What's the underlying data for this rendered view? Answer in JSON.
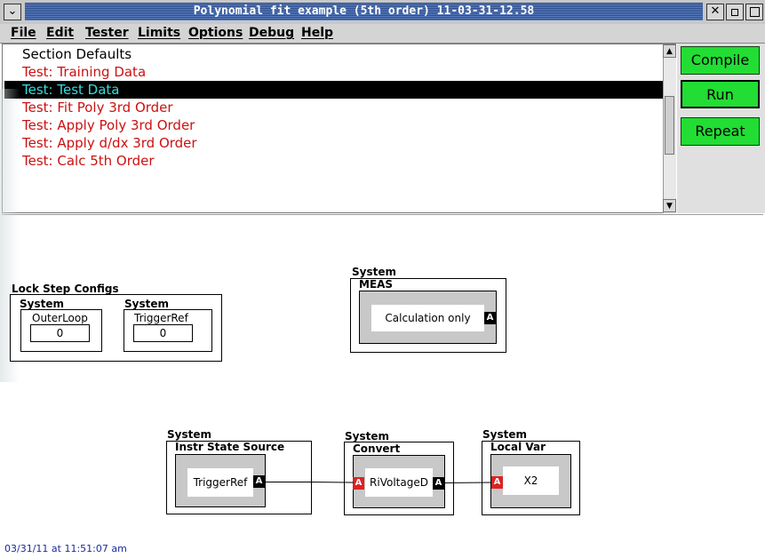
{
  "window": {
    "title": "Polynomial fit example (5th order) 11-03-31-12.58"
  },
  "menu": [
    "File",
    "Edit",
    "Tester",
    "Limits",
    "Options",
    "Debug",
    "Help"
  ],
  "tests": [
    {
      "label": "Section Defaults",
      "color": "#000000"
    },
    {
      "label": "Test: Training Data",
      "color": "#cc1111"
    },
    {
      "label": "Test: Test Data",
      "color": "#33dddd",
      "selected": true
    },
    {
      "label": "Test: Fit Poly 3rd Order",
      "color": "#cc1111"
    },
    {
      "label": "Test: Apply Poly 3rd Order",
      "color": "#cc1111"
    },
    {
      "label": "Test: Apply d/dx 3rd Order",
      "color": "#cc1111"
    },
    {
      "label": "Test: Calc 5th Order",
      "color": "#cc1111"
    }
  ],
  "buttons": {
    "compile": "Compile",
    "run": "Run",
    "repeat": "Repeat"
  },
  "diagram": {
    "lockstep": {
      "title": "Lock Step Configs",
      "outer": {
        "system": "System",
        "name": "OuterLoop",
        "value": "0"
      },
      "trigger": {
        "system": "System",
        "name": "TriggerRef",
        "value": "0"
      }
    },
    "meas": {
      "system": "System",
      "name": "MEAS",
      "content": "Calculation only",
      "port_out": "A"
    },
    "instr": {
      "system": "System",
      "name": "Instr State Source",
      "content": "TriggerRef",
      "port_out": "A"
    },
    "convert": {
      "system": "System",
      "name": "Convert",
      "content": "RiVoltageD",
      "port_in": "A",
      "port_out": "A"
    },
    "localvar": {
      "system": "System",
      "name": "Local Var",
      "content": "X2",
      "port_in": "A"
    }
  },
  "status": "03/31/11 at 11:51:07 am",
  "colors": {
    "accent_green": "#22dd33",
    "selection_bg": "#000000",
    "error_red": "#cc1111"
  }
}
